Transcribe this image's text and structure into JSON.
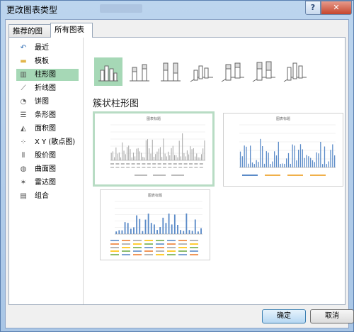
{
  "window": {
    "title": "更改图表类型",
    "help": "?",
    "close": "✕"
  },
  "tabs": [
    "推荐的图表",
    "所有图表"
  ],
  "categories": [
    {
      "label": "最近",
      "icon": "↶"
    },
    {
      "label": "模板",
      "icon": "▬"
    },
    {
      "label": "柱形图",
      "icon": "▥"
    },
    {
      "label": "折线图",
      "icon": "⟋"
    },
    {
      "label": "饼图",
      "icon": "◔"
    },
    {
      "label": "条形图",
      "icon": "☰"
    },
    {
      "label": "面积图",
      "icon": "◭"
    },
    {
      "label": "X Y (散点图)",
      "icon": "⁘"
    },
    {
      "label": "股价图",
      "icon": "⫴"
    },
    {
      "label": "曲面图",
      "icon": "◍"
    },
    {
      "label": "雷达图",
      "icon": "✶"
    },
    {
      "label": "组合",
      "icon": "▤"
    }
  ],
  "selected_category": "柱形图",
  "subtype_heading": "簇状柱形图",
  "preview_title": "图表标题",
  "buttons": {
    "ok": "确定",
    "cancel": "取消"
  },
  "colors": {
    "accent": "#a6d8b6",
    "bar": "#5b8bc8",
    "bar_grey": "#a6a6a6"
  }
}
